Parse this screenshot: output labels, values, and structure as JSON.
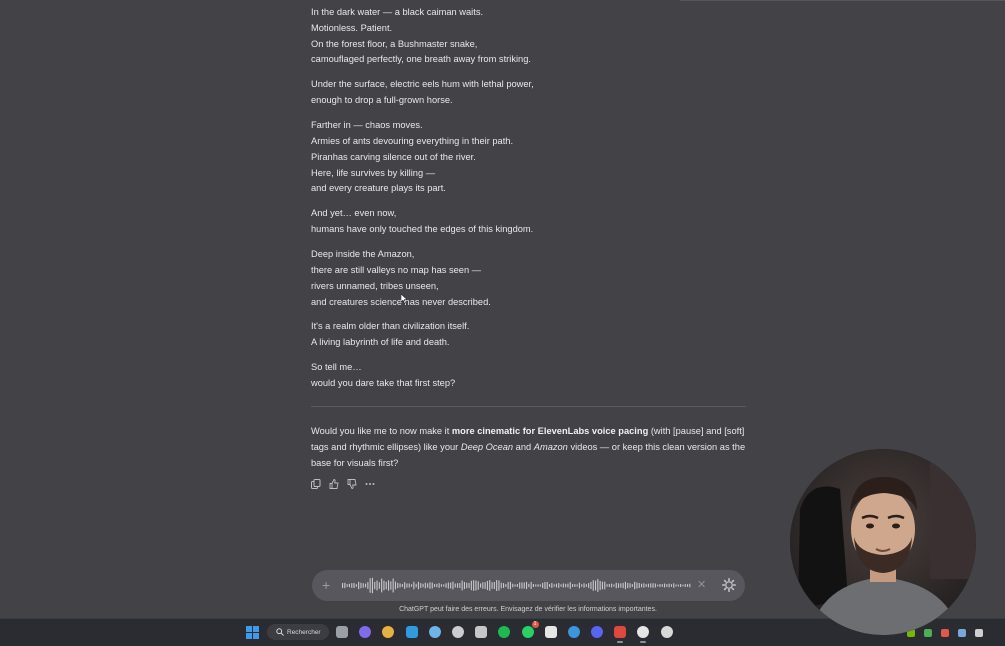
{
  "poem": {
    "stanzas": [
      [
        "In the dark water — a black caiman waits.",
        "Motionless. Patient.",
        "On the forest floor, a Bushmaster snake,",
        "camouflaged perfectly, one breath away from striking."
      ],
      [
        "Under the surface, electric eels hum with lethal power,",
        "enough to drop a full-grown horse."
      ],
      [
        "Farther in — chaos moves.",
        "Armies of ants devouring everything in their path.",
        "Piranhas carving silence out of the river.",
        "Here, life survives by killing —",
        "and every creature plays its part."
      ],
      [
        "And yet… even now,",
        "humans have only touched the edges of this kingdom."
      ],
      [
        "Deep inside the Amazon,",
        "there are still valleys no map has seen —",
        "rivers unnamed, tribes unseen,",
        "and creatures science has never described."
      ],
      [
        "It's a realm older than civilization itself.",
        "A living labyrinth of life and death."
      ],
      [
        "So tell me…",
        "would you dare take that first step?"
      ]
    ]
  },
  "followup": {
    "t1": "Would you like me to now make it ",
    "b1": "more cinematic for ElevenLabs voice pacing",
    "t2": " (with [pause] and [soft] tags and rhythmic ellipses) like your ",
    "i1": "Deep Ocean",
    "t3": " and ",
    "i2": "Amazon",
    "t4": " videos — or keep this clean version as the base for visuals first?"
  },
  "message_actions": [
    {
      "name": "copy-icon"
    },
    {
      "name": "thumbs-up-icon"
    },
    {
      "name": "thumbs-down-icon"
    },
    {
      "name": "more-options-icon"
    }
  ],
  "composer": {
    "plus_icon": "plus-icon",
    "cancel_symbol": "✕",
    "settings_icon": "gear-icon"
  },
  "disclaimer": "ChatGPT peut faire des erreurs. Envisagez de vérifier les informations importantes.",
  "taskbar": {
    "search_label": "Rechercher",
    "apps": [
      {
        "name": "task-view-icon",
        "color": "#9aa0a6"
      },
      {
        "name": "copilot-icon",
        "color": "#7d6cf0"
      },
      {
        "name": "file-explorer-icon",
        "color": "#e8b33c"
      },
      {
        "name": "edge-icon",
        "color": "#2f9be0"
      },
      {
        "name": "paint-icon",
        "color": "#6fb4e8"
      },
      {
        "name": "store-icon",
        "color": "#c9ccd1"
      },
      {
        "name": "davinci-resolve-icon",
        "color": "#c7c7c7"
      },
      {
        "name": "spotify-icon",
        "color": "#1db954"
      },
      {
        "name": "whatsapp-icon",
        "color": "#25d366",
        "badge": "1"
      },
      {
        "name": "capcut-icon",
        "color": "#e6e6e6"
      },
      {
        "name": "vscode-icon",
        "color": "#3a96dd"
      },
      {
        "name": "discord-icon",
        "color": "#5865f2"
      },
      {
        "name": "chrome-icon",
        "color": "#e0483e",
        "active": true
      },
      {
        "name": "capcut-alt-icon",
        "color": "#e6e6e6",
        "active": true
      },
      {
        "name": "media-player-icon",
        "color": "#d9d9d9"
      }
    ],
    "tray": [
      {
        "name": "nvidia-icon",
        "color": "#76b900"
      },
      {
        "name": "shield-icon",
        "color": "#4caf50"
      },
      {
        "name": "microphone-icon",
        "color": "#e0584b"
      },
      {
        "name": "network-icon",
        "color": "#7aa7d9"
      },
      {
        "name": "printer-icon",
        "color": "#cfcfcf"
      }
    ]
  }
}
